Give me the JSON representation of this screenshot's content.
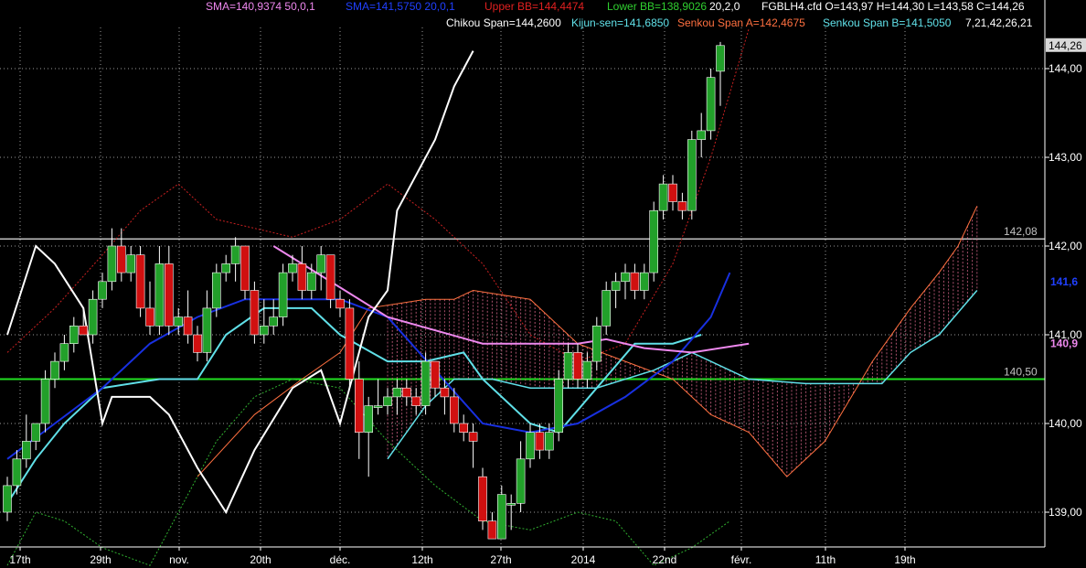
{
  "header": {
    "sma1": "SMA=140,9374  50,0,1",
    "sma2": "SMA=141,5750  20,0,1",
    "upper_bb": "Upper BB=144,4474",
    "lower_bb": "Lower BB=138,9026",
    "bb_params": "20,2,0",
    "symbol_info": "FGBLH4.cfd O=143,97 H=144,30 L=143,58 C=144,26",
    "chikou": "Chikou Span=144,2600",
    "kijun": "Kijun-sen=141,6850",
    "senkou_a": "Senkou Span A=142,4675",
    "senkou_b": "Senkou Span B=141,5050",
    "ichimoku_params": "7,21,42,26,21"
  },
  "colors": {
    "background": "#000000",
    "bull": "#22a02a",
    "bear": "#d01010",
    "sma50": "#ee88ee",
    "sma20": "#1830e0",
    "bb": "#c82020",
    "chikou": "#ffffff",
    "kijun": "#60e0e8",
    "senkou_a": "#ff7040",
    "senkou_b": "#60e0e8",
    "lower_bb": "#30b030",
    "hline_white": "#c0c0c0",
    "hline_green": "#22e022"
  },
  "chart_data": {
    "type": "candlestick",
    "y_ticks": [
      "144,00",
      "143,00",
      "142,00",
      "141,00",
      "140,00",
      "139,00"
    ],
    "y_tick_values": [
      144,
      143,
      142,
      141,
      140,
      139
    ],
    "ylim": [
      138.3,
      144.6
    ],
    "x_labels": [
      "17th",
      "29th",
      "nov.",
      "20th",
      "déc.",
      "12th",
      "27th",
      "2014",
      "22nd",
      "févr.",
      "11th",
      "19th"
    ],
    "price_tags": {
      "last": "144,26",
      "hline_white": "142,08",
      "hline_green": "140,50",
      "sma20_tag": "141,6",
      "sma50_tag": "140,9"
    },
    "hlines": [
      142.08,
      140.5
    ],
    "candles": [
      [
        139.0,
        139.4,
        138.9,
        139.3
      ],
      [
        139.3,
        139.7,
        139.2,
        139.6
      ],
      [
        139.6,
        140.1,
        139.5,
        139.8
      ],
      [
        139.8,
        140.0,
        139.7,
        140.0
      ],
      [
        140.0,
        140.6,
        139.9,
        140.5
      ],
      [
        140.5,
        140.8,
        140.4,
        140.7
      ],
      [
        140.7,
        141.0,
        140.6,
        140.9
      ],
      [
        140.9,
        141.2,
        140.8,
        141.1
      ],
      [
        141.1,
        141.3,
        141.0,
        141.0
      ],
      [
        141.0,
        141.5,
        140.9,
        141.4
      ],
      [
        141.4,
        141.7,
        141.3,
        141.6
      ],
      [
        141.6,
        142.2,
        141.5,
        142.0
      ],
      [
        142.0,
        142.2,
        141.6,
        141.7
      ],
      [
        141.7,
        142.0,
        141.6,
        141.9
      ],
      [
        141.9,
        142.0,
        141.2,
        141.3
      ],
      [
        141.3,
        141.6,
        141.0,
        141.1
      ],
      [
        141.1,
        142.0,
        141.0,
        141.8
      ],
      [
        141.8,
        142.0,
        141.0,
        141.1
      ],
      [
        141.1,
        141.3,
        141.0,
        141.2
      ],
      [
        141.2,
        141.5,
        140.9,
        141.0
      ],
      [
        141.0,
        141.1,
        140.7,
        140.8
      ],
      [
        140.8,
        141.5,
        140.7,
        141.3
      ],
      [
        141.3,
        141.8,
        141.2,
        141.7
      ],
      [
        141.7,
        141.9,
        141.6,
        141.8
      ],
      [
        141.8,
        142.1,
        141.6,
        142.0
      ],
      [
        142.0,
        142.0,
        141.4,
        141.5
      ],
      [
        141.5,
        141.6,
        140.9,
        141.0
      ],
      [
        141.0,
        141.4,
        140.9,
        141.1
      ],
      [
        141.1,
        141.4,
        141.0,
        141.2
      ],
      [
        141.2,
        141.8,
        141.1,
        141.7
      ],
      [
        141.7,
        141.9,
        141.6,
        141.8
      ],
      [
        141.8,
        142.0,
        141.4,
        141.5
      ],
      [
        141.5,
        141.8,
        141.4,
        141.7
      ],
      [
        141.7,
        142.0,
        141.5,
        141.9
      ],
      [
        141.9,
        141.9,
        141.3,
        141.4
      ],
      [
        141.4,
        141.5,
        141.2,
        141.3
      ],
      [
        141.3,
        141.4,
        140.4,
        140.5
      ],
      [
        140.5,
        140.7,
        139.6,
        139.9
      ],
      [
        139.9,
        140.3,
        139.4,
        140.2
      ],
      [
        140.2,
        140.5,
        140.1,
        140.2
      ],
      [
        140.2,
        140.4,
        140.1,
        140.3
      ],
      [
        140.3,
        140.5,
        140.1,
        140.4
      ],
      [
        140.4,
        140.5,
        140.2,
        140.3
      ],
      [
        140.3,
        140.4,
        140.1,
        140.2
      ],
      [
        140.2,
        140.8,
        140.1,
        140.7
      ],
      [
        140.7,
        140.7,
        140.3,
        140.4
      ],
      [
        140.4,
        140.5,
        140.1,
        140.3
      ],
      [
        140.3,
        140.4,
        139.9,
        140.0
      ],
      [
        140.0,
        140.1,
        139.8,
        139.9
      ],
      [
        139.9,
        140.0,
        139.5,
        139.8
      ],
      [
        139.4,
        139.5,
        138.8,
        138.9
      ],
      [
        138.9,
        139.0,
        138.7,
        138.7
      ],
      [
        138.7,
        139.3,
        138.7,
        139.2
      ],
      [
        139.1,
        139.2,
        138.8,
        139.1
      ],
      [
        139.1,
        139.8,
        139.0,
        139.6
      ],
      [
        139.6,
        140.0,
        139.5,
        139.9
      ],
      [
        139.9,
        140.0,
        139.6,
        139.7
      ],
      [
        139.7,
        140.0,
        139.6,
        139.9
      ],
      [
        139.9,
        140.6,
        139.8,
        140.5
      ],
      [
        140.5,
        140.9,
        140.4,
        140.8
      ],
      [
        140.8,
        140.9,
        140.4,
        140.5
      ],
      [
        140.5,
        140.8,
        140.4,
        140.7
      ],
      [
        140.7,
        141.2,
        140.6,
        141.1
      ],
      [
        141.1,
        141.6,
        141.0,
        141.5
      ],
      [
        141.5,
        141.7,
        141.3,
        141.6
      ],
      [
        141.6,
        141.8,
        141.4,
        141.7
      ],
      [
        141.7,
        141.8,
        141.4,
        141.5
      ],
      [
        141.5,
        141.8,
        141.4,
        141.7
      ],
      [
        141.7,
        142.5,
        141.6,
        142.4
      ],
      [
        142.4,
        142.8,
        142.3,
        142.7
      ],
      [
        142.7,
        142.8,
        142.4,
        142.5
      ],
      [
        142.5,
        142.6,
        142.3,
        142.4
      ],
      [
        142.4,
        143.3,
        142.3,
        143.2
      ],
      [
        143.2,
        143.5,
        143.0,
        143.3
      ],
      [
        143.3,
        144.0,
        143.2,
        143.9
      ],
      [
        143.97,
        144.3,
        143.58,
        144.26
      ]
    ],
    "sma50": [
      [
        28,
        142.0
      ],
      [
        40,
        141.2
      ],
      [
        50,
        140.9
      ],
      [
        60,
        140.9
      ],
      [
        63,
        140.95
      ],
      [
        67,
        140.85
      ],
      [
        72,
        140.8
      ],
      [
        78,
        140.9
      ]
    ],
    "sma20": [
      [
        0,
        139.6
      ],
      [
        5,
        140.0
      ],
      [
        10,
        140.4
      ],
      [
        15,
        140.9
      ],
      [
        20,
        141.2
      ],
      [
        25,
        141.4
      ],
      [
        30,
        141.4
      ],
      [
        35,
        141.4
      ],
      [
        40,
        141.2
      ],
      [
        45,
        140.6
      ],
      [
        50,
        140.0
      ],
      [
        55,
        139.9
      ],
      [
        60,
        140.0
      ],
      [
        65,
        140.3
      ],
      [
        70,
        140.7
      ],
      [
        74,
        141.2
      ],
      [
        76,
        141.7
      ]
    ],
    "kijun": [
      [
        0,
        139.1
      ],
      [
        3,
        139.6
      ],
      [
        6,
        140.0
      ],
      [
        10,
        140.4
      ],
      [
        16,
        140.5
      ],
      [
        20,
        140.5
      ],
      [
        23,
        141.0
      ],
      [
        27,
        141.3
      ],
      [
        32,
        141.3
      ],
      [
        35,
        141.0
      ],
      [
        40,
        140.7
      ],
      [
        44,
        140.7
      ],
      [
        48,
        140.8
      ],
      [
        50,
        140.5
      ],
      [
        55,
        140.0
      ],
      [
        58,
        139.9
      ],
      [
        62,
        140.4
      ],
      [
        66,
        140.9
      ],
      [
        70,
        140.9
      ],
      [
        73,
        141.0
      ]
    ],
    "chikou": [
      [
        0,
        141.0
      ],
      [
        3,
        142.0
      ],
      [
        5,
        141.8
      ],
      [
        8,
        141.3
      ],
      [
        10,
        140.0
      ],
      [
        11,
        140.3
      ],
      [
        15,
        140.3
      ],
      [
        17,
        140.1
      ],
      [
        20,
        139.5
      ],
      [
        23,
        139.0
      ],
      [
        26,
        139.7
      ],
      [
        30,
        140.4
      ],
      [
        33,
        140.6
      ],
      [
        35,
        140.0
      ],
      [
        38,
        141.2
      ],
      [
        40,
        141.5
      ],
      [
        41,
        142.4
      ],
      [
        42,
        142.6
      ],
      [
        45,
        143.2
      ],
      [
        47,
        143.8
      ],
      [
        49,
        144.2
      ]
    ],
    "senkou_a": [
      [
        20,
        139.4
      ],
      [
        26,
        140.1
      ],
      [
        31,
        140.5
      ],
      [
        35,
        140.8
      ],
      [
        38,
        141.3
      ],
      [
        44,
        141.4
      ],
      [
        47,
        141.4
      ],
      [
        49,
        141.5
      ],
      [
        55,
        141.4
      ],
      [
        60,
        140.9
      ],
      [
        65,
        140.7
      ],
      [
        70,
        140.5
      ],
      [
        74,
        140.1
      ],
      [
        78,
        139.9
      ],
      [
        82,
        139.4
      ],
      [
        86,
        139.8
      ],
      [
        91,
        140.7
      ],
      [
        95,
        141.3
      ],
      [
        98,
        141.7
      ],
      [
        100,
        142.0
      ],
      [
        102,
        142.45
      ]
    ],
    "senkou_b": [
      [
        40,
        139.6
      ],
      [
        44,
        140.2
      ],
      [
        47,
        140.5
      ],
      [
        51,
        140.5
      ],
      [
        55,
        140.4
      ],
      [
        58,
        140.4
      ],
      [
        62,
        140.4
      ],
      [
        68,
        140.6
      ],
      [
        72,
        140.8
      ],
      [
        78,
        140.5
      ],
      [
        84,
        140.45
      ],
      [
        92,
        140.45
      ],
      [
        95,
        140.8
      ],
      [
        98,
        141.0
      ],
      [
        102,
        141.5
      ]
    ],
    "upper_bb": [
      [
        0,
        140.8
      ],
      [
        5,
        141.3
      ],
      [
        10,
        141.9
      ],
      [
        14,
        142.4
      ],
      [
        18,
        142.7
      ],
      [
        22,
        142.3
      ],
      [
        26,
        142.2
      ],
      [
        30,
        142.1
      ],
      [
        35,
        142.3
      ],
      [
        40,
        142.7
      ],
      [
        45,
        142.3
      ],
      [
        50,
        141.8
      ],
      [
        55,
        141.0
      ],
      [
        60,
        140.7
      ],
      [
        65,
        140.9
      ],
      [
        70,
        141.8
      ],
      [
        74,
        143.0
      ],
      [
        78,
        144.45
      ]
    ],
    "lower_bb": [
      [
        0,
        138.4
      ],
      [
        3,
        139.0
      ],
      [
        6,
        138.9
      ],
      [
        10,
        138.6
      ],
      [
        15,
        138.4
      ],
      [
        18,
        139.0
      ],
      [
        22,
        139.8
      ],
      [
        26,
        140.3
      ],
      [
        30,
        140.5
      ],
      [
        35,
        140.4
      ],
      [
        40,
        139.8
      ],
      [
        45,
        139.3
      ],
      [
        50,
        138.9
      ],
      [
        55,
        138.8
      ],
      [
        60,
        139.0
      ],
      [
        64,
        138.9
      ],
      [
        68,
        138.4
      ],
      [
        72,
        138.6
      ],
      [
        76,
        138.9
      ]
    ]
  }
}
